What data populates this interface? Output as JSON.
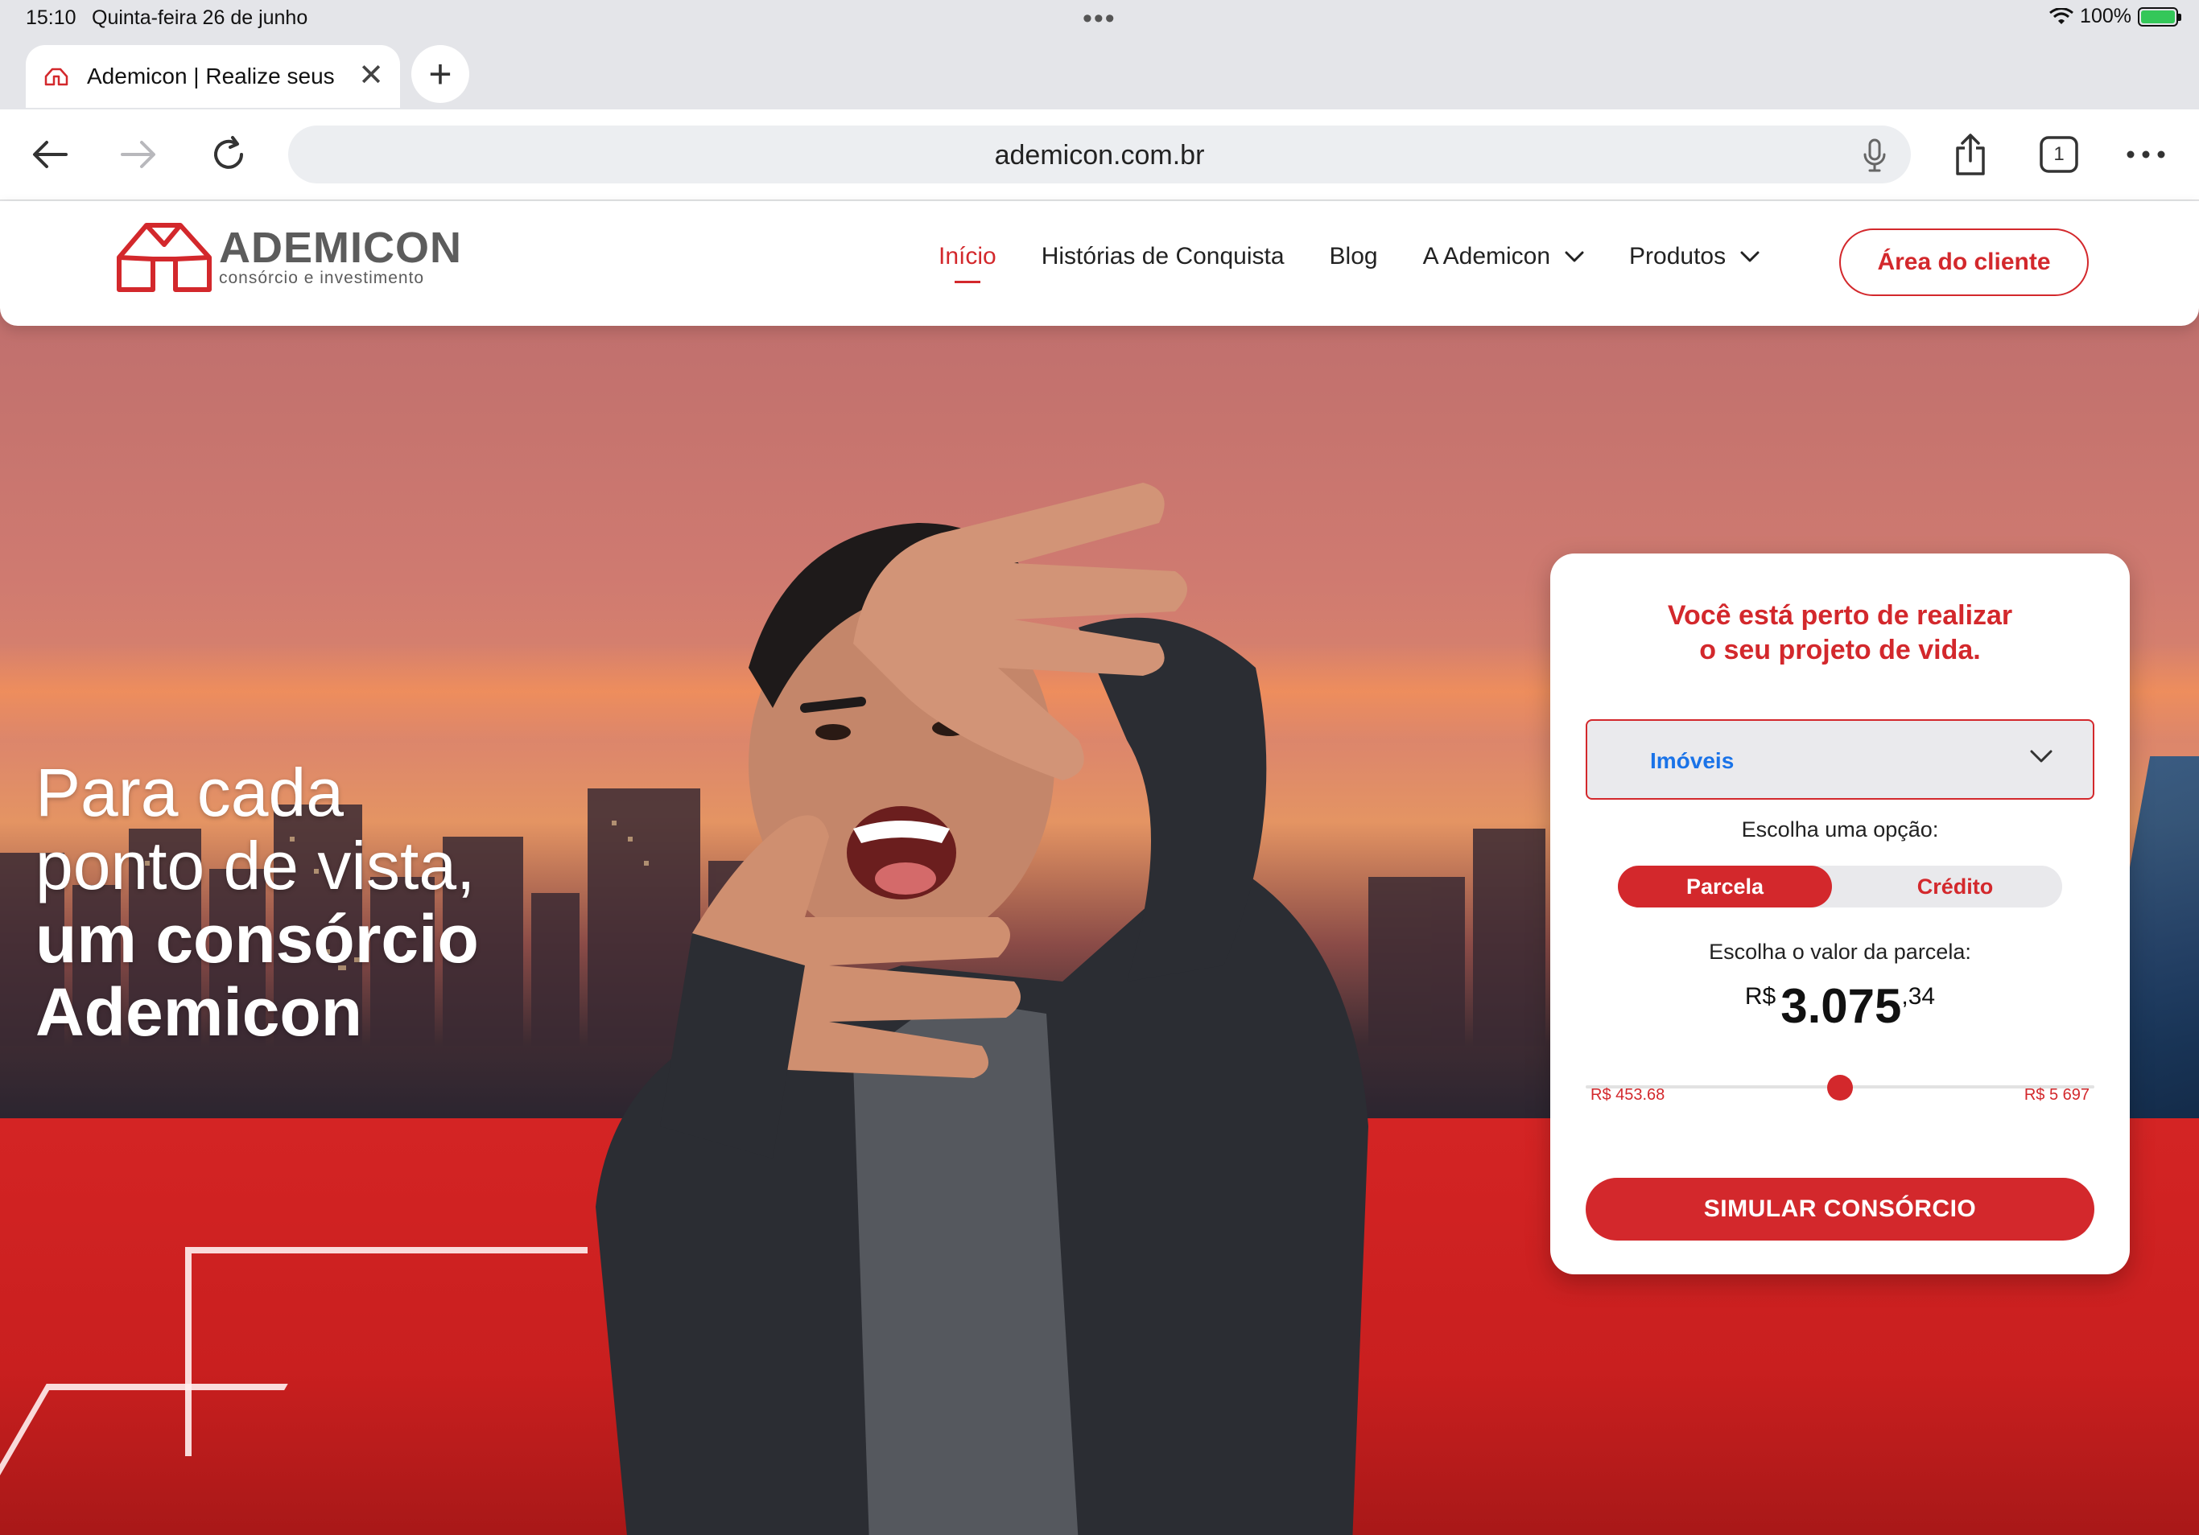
{
  "status_bar": {
    "time": "15:10",
    "date": "Quinta-feira 26 de junho",
    "battery": "100%",
    "battery_level": 1.0
  },
  "browser": {
    "tab_title": "Ademicon | Realize seus",
    "url": "ademicon.com.br",
    "open_tabs": "1"
  },
  "site": {
    "logo_name": "ADEMICON",
    "logo_tagline": "consórcio e investimento",
    "nav": [
      {
        "label": "Início",
        "active": true
      },
      {
        "label": "Histórias de Conquista"
      },
      {
        "label": "Blog"
      },
      {
        "label": "A Ademicon",
        "dropdown": true
      },
      {
        "label": "Produtos",
        "dropdown": true
      }
    ],
    "client_button": "Área do cliente",
    "brand_color": "#d3282c"
  },
  "hero": {
    "line1": "Para cada",
    "line2": "ponto de vista,",
    "line3": "um consórcio",
    "line4": "Ademicon"
  },
  "simulator": {
    "title_line1": "Você está perto de realizar",
    "title_line2": "o seu projeto de vida.",
    "category": "Imóveis",
    "option_label": "Escolha uma opção:",
    "option_selected": "Parcela",
    "option_other": "Crédito",
    "value_label": "Escolha o valor da parcela:",
    "currency": "R$",
    "value_int": "3.075",
    "value_dec": ",34",
    "slider_min": "R$ 453.68",
    "slider_max": "R$ 5 697",
    "slider_fraction": 0.5,
    "cta": "SIMULAR CONSÓRCIO"
  }
}
